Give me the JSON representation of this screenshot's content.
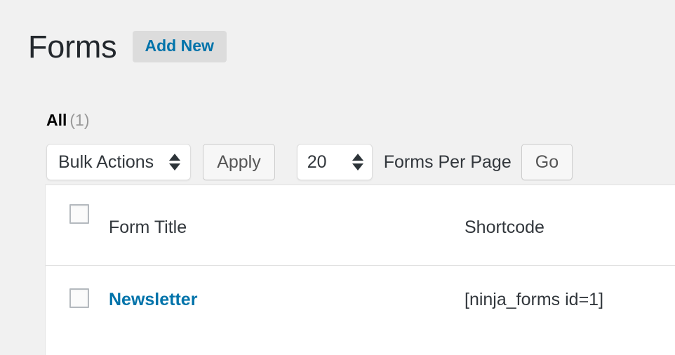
{
  "header": {
    "title": "Forms",
    "add_new_label": "Add New"
  },
  "filters": {
    "all_label": "All",
    "all_count": "(1)"
  },
  "toolbar": {
    "bulk_actions_value": "Bulk Actions",
    "apply_label": "Apply",
    "per_page_value": "20",
    "per_page_label": "Forms Per Page",
    "go_label": "Go"
  },
  "table": {
    "columns": [
      {
        "key": "select_all",
        "label": ""
      },
      {
        "key": "title",
        "label": "Form Title"
      },
      {
        "key": "shortcode",
        "label": "Shortcode"
      }
    ],
    "rows": [
      {
        "title": "Newsletter",
        "shortcode": "[ninja_forms id=1]"
      }
    ]
  },
  "colors": {
    "background": "#f1f1f1",
    "link": "#0073aa",
    "text": "#32373c",
    "muted": "#999999",
    "border": "#e1e1e1",
    "checkbox_border": "#b4b9be",
    "button_face": "#f7f7f7",
    "add_new_face": "#dcdcdc"
  }
}
